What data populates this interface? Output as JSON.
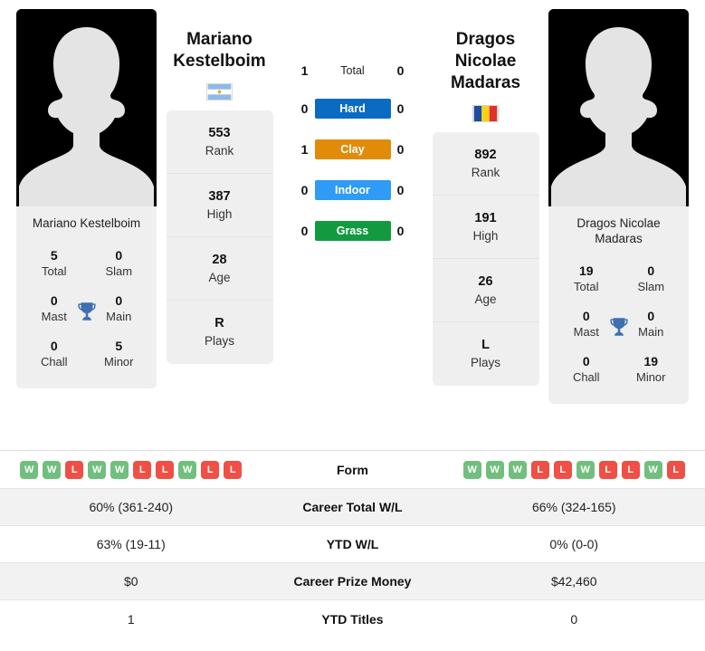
{
  "players": {
    "left": {
      "name_line1": "Mariano",
      "name_line2": "Kestelboim",
      "full_name": "Mariano Kestelboim",
      "country": "Argentina",
      "flag": "argentina-flag",
      "titles": {
        "total_value": "5",
        "total_label": "Total",
        "slam_value": "0",
        "slam_label": "Slam",
        "mast_value": "0",
        "mast_label": "Mast",
        "main_value": "0",
        "main_label": "Main",
        "chall_value": "0",
        "chall_label": "Chall",
        "minor_value": "5",
        "minor_label": "Minor"
      },
      "attributes": [
        {
          "value": "553",
          "label": "Rank"
        },
        {
          "value": "387",
          "label": "High"
        },
        {
          "value": "28",
          "label": "Age"
        },
        {
          "value": "R",
          "label": "Plays"
        }
      ],
      "form": [
        "W",
        "W",
        "L",
        "W",
        "W",
        "L",
        "L",
        "W",
        "L",
        "L"
      ],
      "career_total_wl": "60% (361-240)",
      "ytd_wl": "63% (19-11)",
      "career_prize_money": "$0",
      "ytd_titles": "1"
    },
    "right": {
      "name_line1": "Dragos Nicolae",
      "name_line2": "Madaras",
      "full_name_line1": "Dragos Nicolae",
      "full_name_line2": "Madaras",
      "country": "Romania",
      "flag": "romania-flag",
      "titles": {
        "total_value": "19",
        "total_label": "Total",
        "slam_value": "0",
        "slam_label": "Slam",
        "mast_value": "0",
        "mast_label": "Mast",
        "main_value": "0",
        "main_label": "Main",
        "chall_value": "0",
        "chall_label": "Chall",
        "minor_value": "19",
        "minor_label": "Minor"
      },
      "attributes": [
        {
          "value": "892",
          "label": "Rank"
        },
        {
          "value": "191",
          "label": "High"
        },
        {
          "value": "26",
          "label": "Age"
        },
        {
          "value": "L",
          "label": "Plays"
        }
      ],
      "form": [
        "W",
        "W",
        "W",
        "L",
        "L",
        "W",
        "L",
        "L",
        "W",
        "L"
      ],
      "career_total_wl": "66% (324-165)",
      "ytd_wl": "0% (0-0)",
      "career_prize_money": "$42,460",
      "ytd_titles": "0"
    }
  },
  "head_to_head": [
    {
      "label": "Total",
      "left": "1",
      "right": "0",
      "type": "total",
      "color": ""
    },
    {
      "label": "Hard",
      "left": "0",
      "right": "0",
      "type": "surface",
      "color": "#0b6bc2"
    },
    {
      "label": "Clay",
      "left": "1",
      "right": "0",
      "type": "surface",
      "color": "#e08c08"
    },
    {
      "label": "Indoor",
      "left": "0",
      "right": "0",
      "type": "surface",
      "color": "#2f9bf5"
    },
    {
      "label": "Grass",
      "left": "0",
      "right": "0",
      "type": "surface",
      "color": "#139a41"
    }
  ],
  "stats_table": {
    "rows": [
      {
        "label": "Form",
        "kind": "form"
      },
      {
        "label": "Career Total W/L",
        "kind": "text",
        "left": "60% (361-240)",
        "right": "66% (324-165)"
      },
      {
        "label": "YTD W/L",
        "kind": "text",
        "left": "63% (19-11)",
        "right": "0% (0-0)"
      },
      {
        "label": "Career Prize Money",
        "kind": "text",
        "left": "$0",
        "right": "$42,460"
      },
      {
        "label": "YTD Titles",
        "kind": "text",
        "left": "1",
        "right": "0"
      }
    ]
  },
  "icons": {
    "trophy": "trophy-icon",
    "silhouette": "player-silhouette-icon"
  },
  "colors": {
    "hard": "#0b6bc2",
    "clay": "#e08c08",
    "indoor": "#2f9bf5",
    "grass": "#139a41",
    "win": "#71bf7e",
    "loss": "#ef4f45",
    "trophy": "#3e6fb0",
    "panel": "#efefef"
  }
}
